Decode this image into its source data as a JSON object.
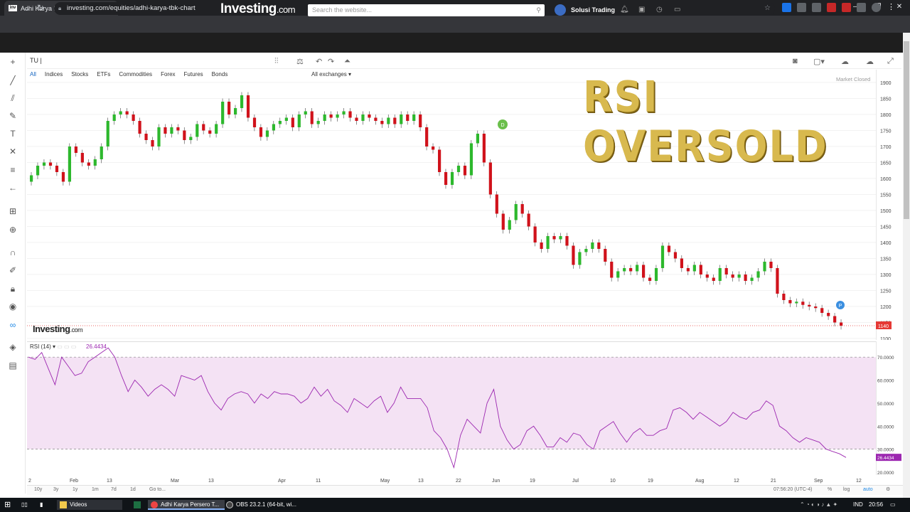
{
  "browser": {
    "tab_title": "Adhi Karya Persero Tbk Chart (A",
    "tab_favicon": "inv",
    "url": "investing.com/equities/adhi-karya-tbk-chart"
  },
  "site": {
    "logo_main": "Investing",
    "logo_suffix": ".com",
    "search_placeholder": "Search the website...",
    "user_name": "Solusi Trading"
  },
  "chart_toolbar": {
    "symbol_input": "TU",
    "filters": [
      "All",
      "Indices",
      "Stocks",
      "ETFs",
      "Commodities",
      "Forex",
      "Futures",
      "Bonds"
    ],
    "exchange_select": "All exchanges",
    "market_status": "Market Closed"
  },
  "overlay_title": "RSI OVERSOLD",
  "watermark": {
    "main": "Investing",
    "suffix": ".com"
  },
  "chart_data": [
    {
      "type": "candlestick",
      "title": "",
      "ylim": [
        1100,
        1900
      ],
      "y_ticks": [
        1900,
        1850,
        1800,
        1750,
        1700,
        1650,
        1600,
        1550,
        1500,
        1450,
        1400,
        1350,
        1300,
        1250,
        1200,
        1150,
        1100
      ],
      "last_price": "1140",
      "close_series": [
        1610,
        1640,
        1650,
        1640,
        1620,
        1590,
        1700,
        1680,
        1650,
        1640,
        1660,
        1700,
        1780,
        1800,
        1810,
        1800,
        1780,
        1740,
        1720,
        1700,
        1760,
        1740,
        1760,
        1750,
        1720,
        1730,
        1770,
        1750,
        1740,
        1770,
        1840,
        1800,
        1820,
        1860,
        1790,
        1760,
        1730,
        1750,
        1770,
        1780,
        1790,
        1760,
        1800,
        1810,
        1770,
        1780,
        1800,
        1790,
        1800,
        1810,
        1790,
        1780,
        1800,
        1790,
        1780,
        1770,
        1790,
        1770,
        1800,
        1780,
        1800,
        1760,
        1700,
        1690,
        1620,
        1580,
        1620,
        1640,
        1610,
        1710,
        1740,
        1650,
        1550,
        1490,
        1440,
        1470,
        1520,
        1490,
        1450,
        1400,
        1380,
        1420,
        1410,
        1420,
        1390,
        1330,
        1370,
        1380,
        1400,
        1380,
        1340,
        1290,
        1310,
        1320,
        1310,
        1330,
        1290,
        1280,
        1320,
        1390,
        1370,
        1350,
        1320,
        1310,
        1330,
        1300,
        1290,
        1280,
        1320,
        1300,
        1290,
        1300,
        1280,
        1290,
        1310,
        1340,
        1320,
        1240,
        1220,
        1210,
        1215,
        1205,
        1200,
        1195,
        1180,
        1170,
        1150,
        1140
      ],
      "x_ticks": [
        "2",
        "Feb",
        "13",
        "Mar",
        "13",
        "Apr",
        "11",
        "May",
        "13",
        "22",
        "Jun",
        "19",
        "Jul",
        "10",
        "19",
        "Aug",
        "12",
        "21",
        "Sep",
        "12"
      ],
      "annotations": [
        "D",
        "P"
      ]
    },
    {
      "type": "line",
      "title": "RSI (14)",
      "current_value": "26.4434",
      "ylim": [
        20,
        75
      ],
      "y_ticks": [
        "70.0000",
        "60.0000",
        "50.0000",
        "40.0000",
        "30.0000",
        "20.0000"
      ],
      "overbought": 70,
      "oversold": 30,
      "values": [
        70,
        69,
        72,
        65,
        58,
        70,
        66,
        62,
        63,
        68,
        70,
        72,
        74,
        70,
        62,
        55,
        60,
        57,
        53,
        56,
        58,
        56,
        53,
        62,
        61,
        60,
        62,
        55,
        50,
        47,
        52,
        54,
        55,
        54,
        50,
        54,
        52,
        55,
        54,
        54,
        53,
        50,
        52,
        57,
        53,
        56,
        51,
        49,
        46,
        52,
        50,
        48,
        51,
        53,
        46,
        50,
        57,
        52,
        52,
        52,
        48,
        38,
        35,
        30,
        22,
        36,
        43,
        40,
        37,
        50,
        56,
        40,
        34,
        30,
        32,
        38,
        40,
        36,
        31,
        31,
        35,
        33,
        37,
        36,
        32,
        30,
        38,
        40,
        42,
        37,
        33,
        37,
        39,
        36,
        36,
        38,
        39,
        47,
        48,
        46,
        43,
        46,
        44,
        42,
        40,
        42,
        46,
        44,
        43,
        46,
        47,
        51,
        49,
        40,
        38,
        35,
        33,
        35,
        34,
        33,
        30,
        29,
        28,
        26.4
      ]
    }
  ],
  "timeframes": [
    "10y",
    "3y",
    "1y",
    "1m",
    "7d",
    "1d",
    "Go to..."
  ],
  "time_status": "07:56:20 (UTC-4)",
  "scale_options": [
    "%",
    "log",
    "auto"
  ],
  "taskbar": {
    "items": [
      "Videos",
      "Adhi Karya Persero T...",
      "OBS 23.2.1 (64-bit, wi..."
    ],
    "lang": "IND",
    "clock": "20:56"
  },
  "colors": {
    "up": "#2db82d",
    "down": "#d0121b",
    "rsi": "#9c27b0",
    "rsi_band": "#f4e2f4",
    "price_line": "#e53935"
  }
}
